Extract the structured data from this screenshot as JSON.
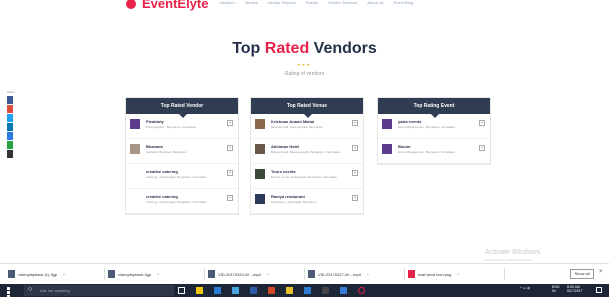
{
  "header": {
    "logo": "EventElyte",
    "nav": [
      "Vendors",
      "Venues",
      "Vendor Reports",
      "Events",
      "Vendor Services",
      "About Us",
      "Event Blog"
    ],
    "accent": "#e8234a"
  },
  "social": {
    "label": "Share",
    "buttons": [
      {
        "icon": "facebook-icon",
        "color": "#3b5998"
      },
      {
        "icon": "google-plus-icon",
        "color": "#dd4b39"
      },
      {
        "icon": "twitter-icon",
        "color": "#1da1f2"
      },
      {
        "icon": "linkedin-icon",
        "color": "#0077b5"
      },
      {
        "icon": "pinterest-icon",
        "color": "#2a7ae2"
      },
      {
        "icon": "whatsapp-icon",
        "color": "#25a244"
      },
      {
        "icon": "email-icon",
        "color": "#333333"
      }
    ]
  },
  "title": {
    "main": "Top ",
    "accent": "Rated",
    "rest": " Vendors",
    "stars": "★ ★ ★",
    "subtitle": "Rating of vendors"
  },
  "columns": [
    {
      "heading": "Top Rated Vendor",
      "items": [
        {
          "title": "Picabloty",
          "desc": "Photographer · Bengaluru, Karnataka",
          "thumb": "#5b3b8c"
        },
        {
          "title": "Bhavana",
          "desc": "Jewellery Boutique, Bangalore",
          "thumb": "#a89585"
        },
        {
          "title": "creative catering",
          "desc": "Catering, Vasantnagar, Bengaluru, Karnataka",
          "thumb": ""
        },
        {
          "title": "creative catering",
          "desc": "Catering, Vasantnagar, Bengaluru, Karnataka",
          "thumb": ""
        }
      ]
    },
    {
      "heading": "Top Rated Venue",
      "items": [
        {
          "title": "Krishnan Anand Mahal",
          "desc": "Banquet Hall, Koramangala, Bengaluru",
          "thumb": "#8a6a4a"
        },
        {
          "title": "Abhiman Hotel",
          "desc": "Banquet Hall, Basavanagudi, Bengaluru, Karnataka",
          "thumb": "#6a5a4a"
        },
        {
          "title": "Tours events",
          "desc": "Events venue, Indiranagar, Bengaluru, Karnataka",
          "thumb": "#3a4a3a"
        },
        {
          "title": "Ramya restaurant",
          "desc": "Restaurant, Jayanagar, Bengaluru",
          "thumb": "#2a3a5a"
        }
      ]
    },
    {
      "heading": "Top Rating Event",
      "items": [
        {
          "title": "yatra events",
          "desc": "Event Management, Bengaluru, Karnataka",
          "thumb": "#5b3b8c"
        },
        {
          "title": "Bloom",
          "desc": "Event Management, Bengaluru, Karnataka",
          "thumb": "#5b3b8c"
        }
      ]
    }
  ],
  "watermark": {
    "title": "Activate Windows",
    "sub": "Go to Settings to activate Windows."
  },
  "downloads": {
    "items": [
      {
        "name": "videoplayback (1).3gp",
        "color": "#4b5a75"
      },
      {
        "name": "videoplayback.3gp",
        "color": "#4b5a75"
      },
      {
        "name": "VID-20170320-W....mp4",
        "color": "#4b5a75"
      },
      {
        "name": "VID-20170327-W....mp4",
        "color": "#4b5a75"
      },
      {
        "name": "mail send icon.png",
        "color": "#e8234a"
      }
    ],
    "show_all": "Show all",
    "close": "×"
  },
  "taskbar": {
    "search_placeholder": "Ask me anything",
    "tray_lang": "ENG",
    "tray_region": "IN",
    "time": "8:00 AM",
    "date": "5/17/2017"
  }
}
